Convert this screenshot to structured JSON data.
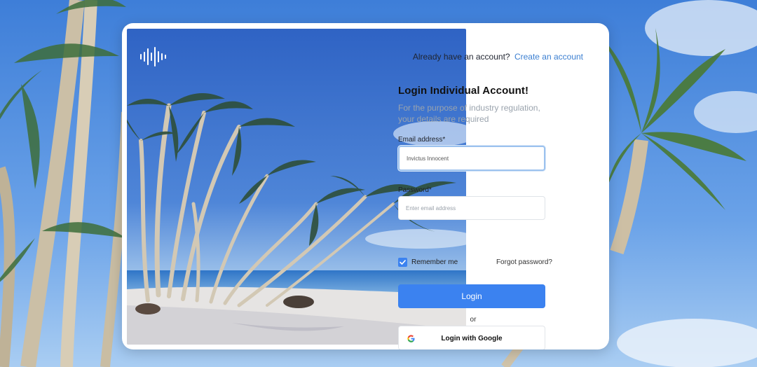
{
  "header": {
    "prompt_text": "Already have an account?",
    "create_link": "Create an account"
  },
  "form": {
    "title": "Login Individual Account!",
    "subtitle": "For the purpose of industry regulation, your details are required",
    "email": {
      "label": "Email address*",
      "value": "Invictus Innocent"
    },
    "password": {
      "label": "Password*",
      "placeholder": "Enter email address"
    },
    "remember": {
      "label": "Remember me",
      "checked": true
    },
    "forgot_label": "Forgot password?",
    "login_label": "Login",
    "or_label": "or",
    "google_label": "Login with Google"
  },
  "icons": {
    "logo": "sound-wave-logo-icon",
    "checkbox": "checkmark-icon",
    "google": "google-icon"
  },
  "colors": {
    "accent": "#3b82f0",
    "link": "#3b7fd1",
    "sky": "#3f7fd9"
  }
}
